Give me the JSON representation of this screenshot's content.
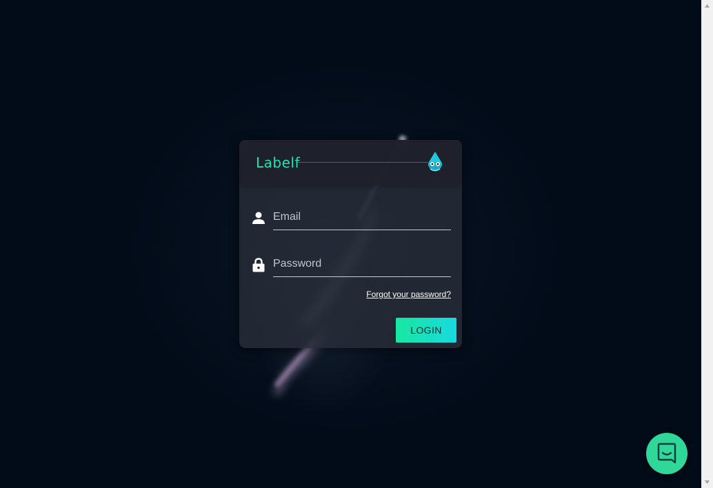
{
  "app": {
    "brand_name": "Labelf",
    "brand_color": "#1fe3b3"
  },
  "login_form": {
    "email": {
      "placeholder": "Email",
      "value": "",
      "icon": "person-icon"
    },
    "password": {
      "placeholder": "Password",
      "value": "",
      "icon": "lock-icon"
    },
    "forgot_password_label": "Forgot your password?",
    "login_button_label": "LOGIN",
    "login_button_colors": [
      "#19e6a0",
      "#19d9e0"
    ]
  },
  "chat_widget": {
    "icon": "chat-icon",
    "color": "#2fd899"
  },
  "background": {
    "color": "#020b18",
    "image": "rocket-launch-night"
  }
}
